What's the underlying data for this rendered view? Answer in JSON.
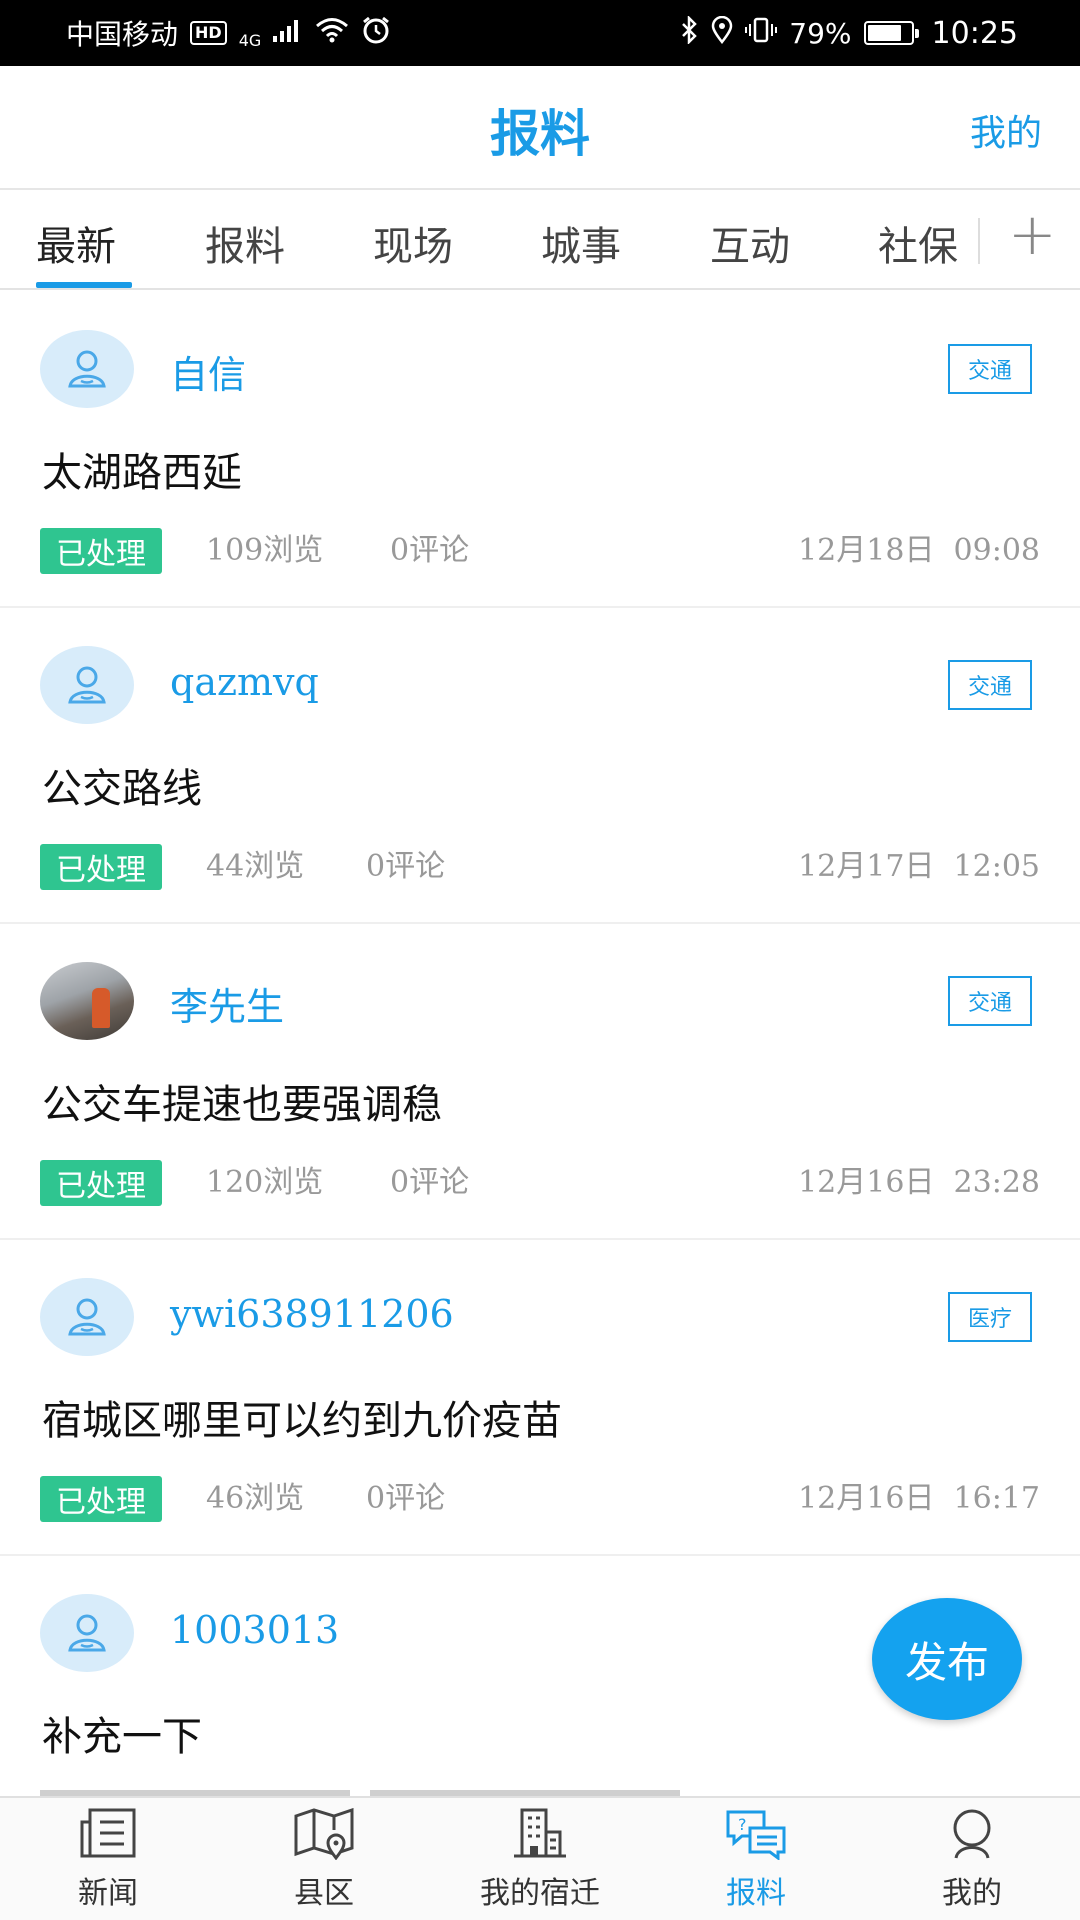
{
  "status_bar": {
    "carrier": "中国移动",
    "hd": "HD",
    "network": "4G",
    "battery": "79%",
    "battery_level": 0.79,
    "time": "10:25"
  },
  "header": {
    "title": "报料",
    "right_link": "我的"
  },
  "tabs": [
    {
      "label": "最新",
      "active": true
    },
    {
      "label": "报料",
      "active": false
    },
    {
      "label": "现场",
      "active": false
    },
    {
      "label": "城事",
      "active": false
    },
    {
      "label": "互动",
      "active": false
    },
    {
      "label": "社保",
      "active": false
    }
  ],
  "tab_add": "+",
  "posts": [
    {
      "user": "自信",
      "avatar": "default",
      "category": "交通",
      "title": "太湖路西延",
      "status": "已处理",
      "views": "109浏览",
      "comments": "0评论",
      "date": "12月18日",
      "time": "09:08"
    },
    {
      "user": "qazmvq",
      "avatar": "default",
      "category": "交通",
      "title": "公交路线",
      "status": "已处理",
      "views": "44浏览",
      "comments": "0评论",
      "date": "12月17日",
      "time": "12:05"
    },
    {
      "user": "李先生",
      "avatar": "photo",
      "category": "交通",
      "title": "公交车提速也要强调稳",
      "status": "已处理",
      "views": "120浏览",
      "comments": "0评论",
      "date": "12月16日",
      "time": "23:28"
    },
    {
      "user": "ywi638911206",
      "avatar": "default",
      "category": "医疗",
      "title": "宿城区哪里可以约到九价疫苗",
      "status": "已处理",
      "views": "46浏览",
      "comments": "0评论",
      "date": "12月16日",
      "time": "16:17"
    },
    {
      "user": "1003013",
      "avatar": "default",
      "category": "",
      "title": "补充一下",
      "status": "",
      "views": "",
      "comments": "",
      "date": "",
      "time": ""
    }
  ],
  "fab_label": "发布",
  "bottom_nav": [
    {
      "label": "新闻",
      "icon": "newspaper-icon",
      "active": false
    },
    {
      "label": "县区",
      "icon": "map-icon",
      "active": false
    },
    {
      "label": "我的宿迁",
      "icon": "building-icon",
      "active": false
    },
    {
      "label": "报料",
      "icon": "chat-report-icon",
      "active": true
    },
    {
      "label": "我的",
      "icon": "user-icon",
      "active": false
    }
  ],
  "colors": {
    "accent": "#1a9be6",
    "status_green": "#2fc590",
    "avatar_bg": "#d8ecfa",
    "fab": "#14a2ef"
  }
}
